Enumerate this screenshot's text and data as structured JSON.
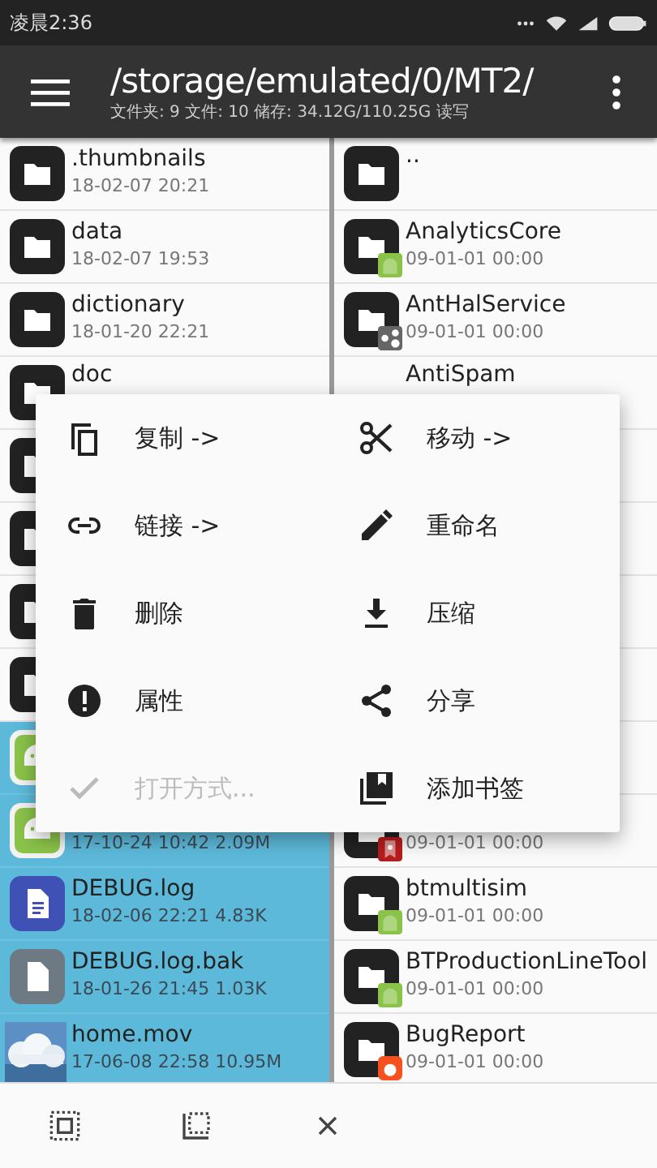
{
  "status_bar": {
    "time": "凌晨2:36"
  },
  "toolbar": {
    "path": "/storage/emulated/0/MT2/",
    "info": "文件夹: 9  文件: 10  储存: 34.12G/110.25G  读写"
  },
  "left_pane": [
    {
      "kind": "folder",
      "name": ".thumbnails",
      "date": "18-02-07 20:21",
      "selected": false
    },
    {
      "kind": "folder",
      "name": "data",
      "date": "18-02-07 19:53",
      "selected": false
    },
    {
      "kind": "folder",
      "name": "dictionary",
      "date": "18-01-20 22:21",
      "selected": false
    },
    {
      "kind": "folder",
      "name": "doc",
      "selected": false
    },
    {
      "kind": "folder",
      "selected": false
    },
    {
      "kind": "folder",
      "selected": false
    },
    {
      "kind": "folder",
      "selected": false
    },
    {
      "kind": "folder",
      "selected": false
    },
    {
      "kind": "apk",
      "selected": true
    },
    {
      "kind": "apk",
      "date": "17-10-24 10:42  2.09M",
      "selected": true
    },
    {
      "kind": "doc",
      "name": "DEBUG.log",
      "date": "18-02-06 22:21  4.83K",
      "selected": true
    },
    {
      "kind": "file",
      "name": "DEBUG.log.bak",
      "date": "18-01-26 21:45  1.03K",
      "selected": true
    },
    {
      "kind": "picture",
      "name": "home.mov",
      "date": "17-06-08 22:58  10.95M",
      "selected": true
    }
  ],
  "right_pane": [
    {
      "kind": "folder",
      "name": ".."
    },
    {
      "kind": "android_folder",
      "name": "AnalyticsCore",
      "date": "09-01-01 00:00"
    },
    {
      "kind": "nodes_folder",
      "name": "AntHalService",
      "date": "09-01-01 00:00"
    },
    {
      "kind": "text_only",
      "name": "AntiSpam"
    },
    {
      "kind": "covered"
    },
    {
      "kind": "covered"
    },
    {
      "kind": "covered"
    },
    {
      "kind": "covered"
    },
    {
      "kind": "covered"
    },
    {
      "kind": "bookmark_folder",
      "date": "09-01-01 00:00"
    },
    {
      "kind": "android_folder",
      "name": "btmultisim",
      "date": "09-01-01 00:00"
    },
    {
      "kind": "android_folder",
      "name": "BTProductionLineTool",
      "date": "09-01-01 00:00"
    },
    {
      "kind": "bug_folder",
      "name": "BugReport",
      "date": "09-01-01 00:00"
    }
  ],
  "context_menu": [
    {
      "label": "复制 ->",
      "disabled": false
    },
    {
      "label": "移动 ->",
      "disabled": false
    },
    {
      "label": "链接 ->",
      "disabled": false
    },
    {
      "label": "重命名",
      "disabled": false
    },
    {
      "label": "删除",
      "disabled": false
    },
    {
      "label": "压缩",
      "disabled": false
    },
    {
      "label": "属性",
      "disabled": false
    },
    {
      "label": "分享",
      "disabled": false
    },
    {
      "label": "打开方式...",
      "disabled": true
    },
    {
      "label": "添加书签",
      "disabled": false
    }
  ]
}
